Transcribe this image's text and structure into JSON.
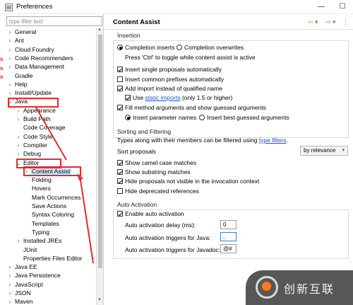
{
  "window": {
    "title": "Preferences",
    "controls": {
      "minimize": "—",
      "maximize": "☐",
      "close": "✕"
    }
  },
  "sidebar": {
    "filter_placeholder": "type filter text",
    "items": [
      {
        "label": "General",
        "level": 0,
        "arrow": "›"
      },
      {
        "label": "Ant",
        "level": 0,
        "arrow": "›"
      },
      {
        "label": "Cloud Foundry",
        "level": 0,
        "arrow": "›"
      },
      {
        "label": "Code Recommenders",
        "level": 0,
        "arrow": "›"
      },
      {
        "label": "Data Management",
        "level": 0,
        "arrow": "›"
      },
      {
        "label": "Gradle",
        "level": 0,
        "arrow": ""
      },
      {
        "label": "Help",
        "level": 0,
        "arrow": "›"
      },
      {
        "label": "Install/Update",
        "level": 0,
        "arrow": "›"
      },
      {
        "label": "Java",
        "level": 0,
        "arrow": "⌄"
      },
      {
        "label": "Appearance",
        "level": 1,
        "arrow": "›"
      },
      {
        "label": "Build Path",
        "level": 1,
        "arrow": "›"
      },
      {
        "label": "Code Coverage",
        "level": 1,
        "arrow": ""
      },
      {
        "label": "Code Style",
        "level": 1,
        "arrow": "›"
      },
      {
        "label": "Compiler",
        "level": 1,
        "arrow": "›"
      },
      {
        "label": "Debug",
        "level": 1,
        "arrow": "›"
      },
      {
        "label": "Editor",
        "level": 1,
        "arrow": "⌄"
      },
      {
        "label": "Content Assist",
        "level": 2,
        "arrow": "›"
      },
      {
        "label": "Folding",
        "level": 2,
        "arrow": ""
      },
      {
        "label": "Hovers",
        "level": 2,
        "arrow": ""
      },
      {
        "label": "Mark Occurrences",
        "level": 2,
        "arrow": ""
      },
      {
        "label": "Save Actions",
        "level": 2,
        "arrow": ""
      },
      {
        "label": "Syntax Coloring",
        "level": 2,
        "arrow": ""
      },
      {
        "label": "Templates",
        "level": 2,
        "arrow": ""
      },
      {
        "label": "Typing",
        "level": 2,
        "arrow": ""
      },
      {
        "label": "Installed JREs",
        "level": 1,
        "arrow": "›"
      },
      {
        "label": "JUnit",
        "level": 1,
        "arrow": ""
      },
      {
        "label": "Properties Files Editor",
        "level": 1,
        "arrow": ""
      },
      {
        "label": "Java EE",
        "level": 0,
        "arrow": "›"
      },
      {
        "label": "Java Persistence",
        "level": 0,
        "arrow": "›"
      },
      {
        "label": "JavaScript",
        "level": 0,
        "arrow": "›"
      },
      {
        "label": "JSON",
        "level": 0,
        "arrow": "›"
      },
      {
        "label": "Maven",
        "level": 0,
        "arrow": "›"
      }
    ],
    "selected_label": "Content Assist",
    "annotation_color": "#e02d2d",
    "selection_color": "#cce8ff"
  },
  "page": {
    "title": "Content Assist",
    "nav_icons": {
      "back": "⇦",
      "back_menu": "▾",
      "forward": "⇨",
      "forward_menu": "▾",
      "menu": "⋮"
    }
  },
  "insertion": {
    "label": "Insertion",
    "completion_inserts": "Completion inserts",
    "completion_overwrites": "Completion overwrites",
    "toggle_hint": "Press 'Ctrl' to toggle while content assist is active",
    "insert_single": "Insert single proposals automatically",
    "insert_common": "Insert common prefixes automatically",
    "add_import": "Add import instead of qualified name",
    "use_label": "Use",
    "static_imports": "static imports",
    "static_imports_note": "(only 1.5 or higher)",
    "fill_args": "Fill method arguments and show guessed arguments",
    "insert_param_names": "Insert parameter names",
    "insert_best_guessed": "Insert best guessed arguments"
  },
  "sorting": {
    "label": "Sorting and Filtering",
    "filter_text_prefix": "Types along with their members can be filtered using",
    "type_filters_link": "type filters",
    "filter_text_suffix": ".",
    "sort_proposals_label": "Sort proposals",
    "sort_value": "by relevance",
    "show_camel": "Show camel case matches",
    "show_substring": "Show substring matches",
    "hide_invisible": "Hide proposals not visible in the invocation context",
    "hide_deprecated": "Hide deprecated references"
  },
  "activation": {
    "label": "Auto Activation",
    "enable": "Enable auto activation",
    "delay_label": "Auto activation delay (ms):",
    "delay_value": "0",
    "java_triggers_label": "Auto activation triggers for Java:",
    "java_triggers_value": ".",
    "javadoc_triggers_label": "Auto activation triggers for Javadoc:",
    "javadoc_triggers_value": "@#"
  },
  "watermark": {
    "text": "创新互联"
  },
  "edge_marks": [
    "s",
    "s",
    "s"
  ]
}
